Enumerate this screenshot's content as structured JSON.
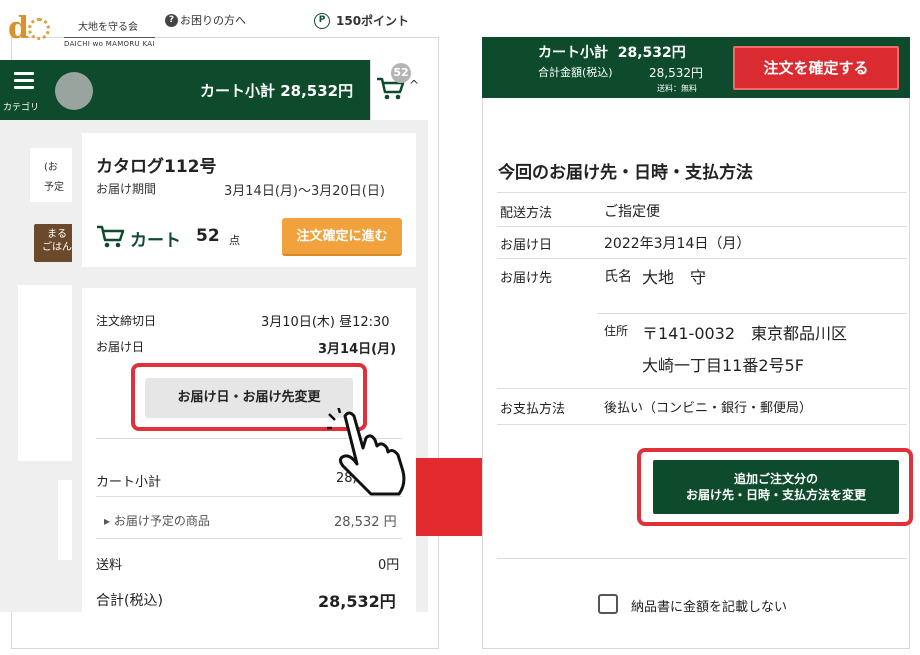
{
  "left": {
    "logo": {
      "jp": "大地を守る会",
      "en": "DAICHI wo MAMORU KAI"
    },
    "help_label": "お困りの方へ",
    "points_label": "150ポイント",
    "menu_label": "カテゴリ",
    "cart_subtotal_label": "カート小計 28,532円",
    "cart_badge": "52",
    "background_items": {
      "ghost_text_1": "(お",
      "ghost_text_2": "予定",
      "ghost_badge_text_1": "まる",
      "ghost_badge_text_2": "ごはん"
    },
    "catalog": {
      "title": "カタログ112号",
      "period_label": "お届け期間",
      "period_value": "3月14日(月)〜3月20日(日)",
      "cart_label": "カート",
      "cart_count": "52",
      "cart_unit": "点",
      "proceed_label": "注文確定に進む"
    },
    "order": {
      "deadline_label": "注文締切日",
      "deadline_value": "3月10日(木) 昼12:30",
      "delivery_label": "お届け日",
      "delivery_value": "3月14日(月)",
      "change_label": "お届け日・お届け先変更",
      "subtotal_label": "カート小計",
      "subtotal_value": "28,5",
      "items_label": "お届け予定の商品",
      "items_value": "28,532 円",
      "shipping_label": "送料",
      "shipping_value": "0円",
      "total_label": "合計(税込)",
      "total_value": "28,532円"
    }
  },
  "right": {
    "subtotal_label": "カート小計",
    "subtotal_value": "28,532円",
    "total_label": "合計金額(税込)",
    "total_value": "28,532円",
    "shipping_note": "送料：無料",
    "confirm_label": "注文を確定する",
    "section_title": "今回のお届け先・日時・支払方法",
    "method_label": "配送方法",
    "method_value": "ご指定便",
    "date_label": "お届け日",
    "date_value": "2022年3月14日（月）",
    "dest_label": "お届け先",
    "name_label": "氏名",
    "name_value": "大地　守",
    "addr_label": "住所",
    "addr_line1": "〒141-0032　東京都品川区",
    "addr_line2": "大崎一丁目11番2号5F",
    "pay_label": "お支払方法",
    "pay_value": "後払い（コンビニ・銀行・郵便局）",
    "add_line1": "追加ご注文分の",
    "add_line2": "お届け先・日時・支払方法を変更",
    "no_price_label": "納品書に金額を記載しない"
  },
  "colors": {
    "brand_green": "#0d4b2c",
    "accent_orange": "#f2a23c",
    "alert_red": "#e32a2f"
  }
}
